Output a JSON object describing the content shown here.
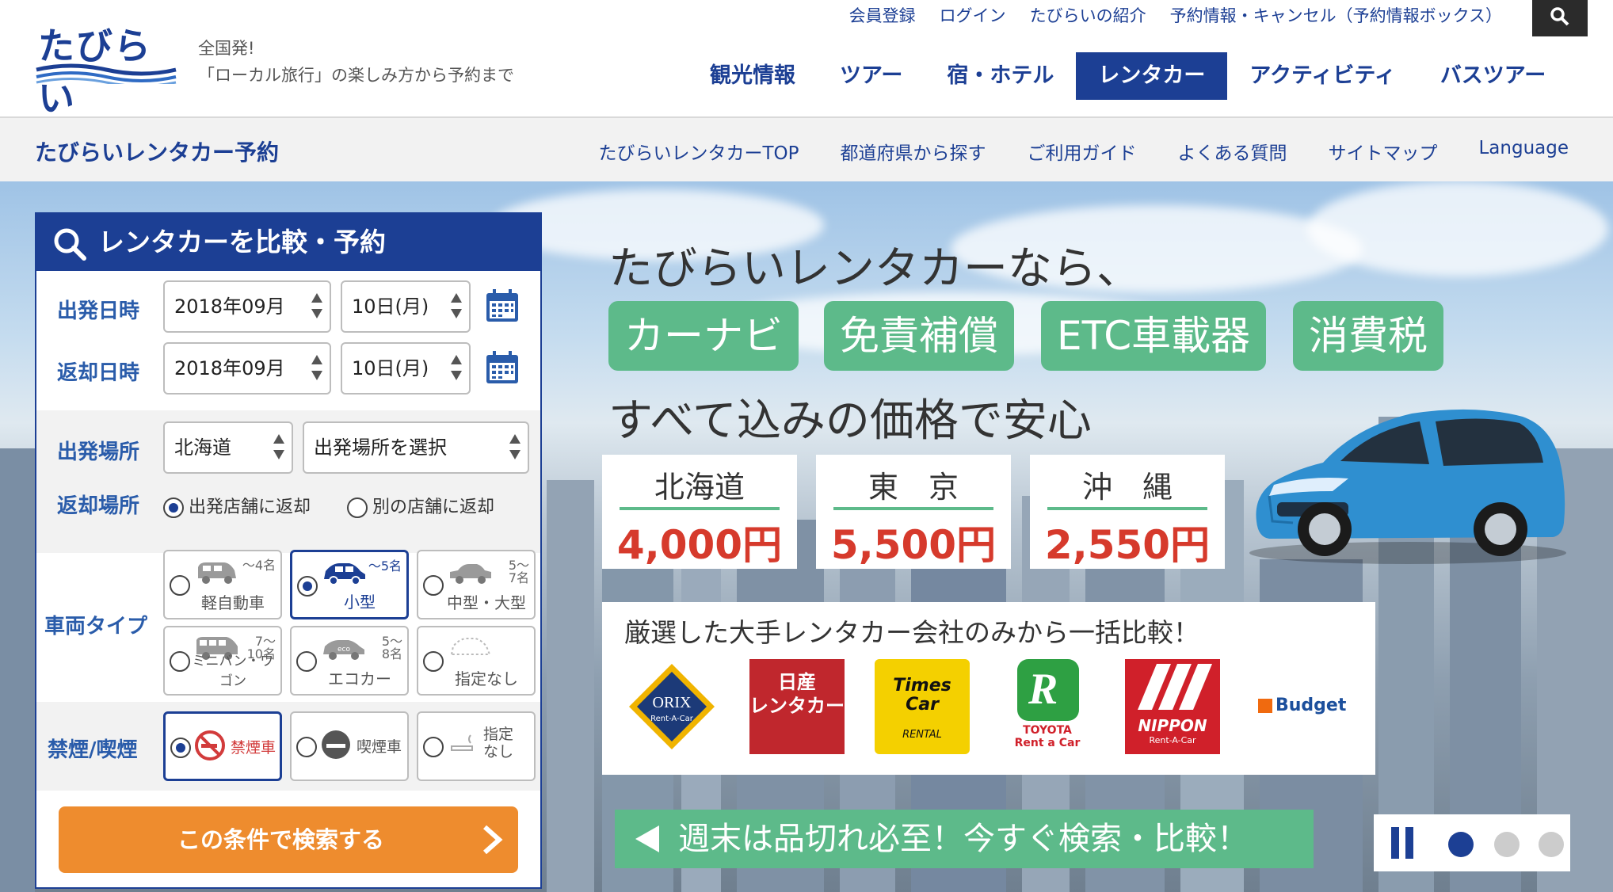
{
  "header": {
    "logo_text": "たびらい",
    "tagline_line1": "全国発!",
    "tagline_line2": "「ローカル旅行」の楽しみ方から予約まで",
    "top_links": [
      "会員登録",
      "ログイン",
      "たびらいの紹介",
      "予約情報・キャンセル（予約情報ボックス）"
    ],
    "main_nav": [
      "観光情報",
      "ツアー",
      "宿・ホテル",
      "レンタカー",
      "アクティビティ",
      "バスツアー"
    ],
    "active_nav": "レンタカー"
  },
  "subnav": {
    "title": "たびらいレンタカー予約",
    "links": [
      "たびらいレンタカーTOP",
      "都道府県から探す",
      "ご利用ガイド",
      "よくある質問",
      "サイトマップ",
      "Language"
    ]
  },
  "search": {
    "title": "レンタカーを比較・予約",
    "depart_label": "出発日時",
    "return_label": "返却日時",
    "depart_month": "2018年09月",
    "depart_day": "10日(月)",
    "return_month": "2018年09月",
    "return_day": "10日(月)",
    "place_label": "出発場所",
    "prefecture": "北海道",
    "place_placeholder": "出発場所を選択",
    "return_place_label": "返却場所",
    "return_same": "出発店舗に返却",
    "return_other": "別の店舗に返却",
    "vehicle_label": "車両タイプ",
    "vehicles": [
      {
        "cap": "〜4名",
        "label": "軽自動車"
      },
      {
        "cap": "〜5名",
        "label": "小型"
      },
      {
        "cap": "5〜\n7名",
        "label": "中型・大型"
      },
      {
        "cap": "7〜\n10名",
        "label": "ミニバン・ワゴン"
      },
      {
        "cap": "5〜\n8名",
        "label": "エコカー"
      },
      {
        "cap": "",
        "label": "指定なし"
      }
    ],
    "smoking_label": "禁煙/喫煙",
    "smoking": [
      "禁煙車",
      "喫煙車",
      "指定\nなし"
    ],
    "button": "この条件で検索する"
  },
  "banner": {
    "headline": "たびらいレンタカーなら、",
    "pills": [
      "カーナビ",
      "免責補償",
      "ETC車載器",
      "消費税"
    ],
    "subline": "すべて込みの価格で安心",
    "prices": [
      {
        "region": "北海道",
        "price": "4,000円"
      },
      {
        "region": "東　京",
        "price": "5,500円"
      },
      {
        "region": "沖　縄",
        "price": "2,550円"
      }
    ],
    "brands_title": "厳選した大手レンタカー会社のみから一括比較！",
    "brands": {
      "orix": "ORIX",
      "orix_sub": "Rent-A-Car",
      "nissan": "日産\nレンタカー",
      "times": "Times\nCar",
      "times_sub": "RENTAL",
      "toyota": "TOYOTA\nRent a Car",
      "nippon": "NIPPON",
      "nippon_sub": "Rent-A-Car",
      "budget": "Budget"
    },
    "cta": "週末は品切れ必至！今すぐ検索・比較！"
  },
  "colors": {
    "brand_blue": "#1c3f94",
    "accent_green": "#5dba8a",
    "button_orange": "#ee8c2e",
    "price_red": "#d63a2c"
  }
}
